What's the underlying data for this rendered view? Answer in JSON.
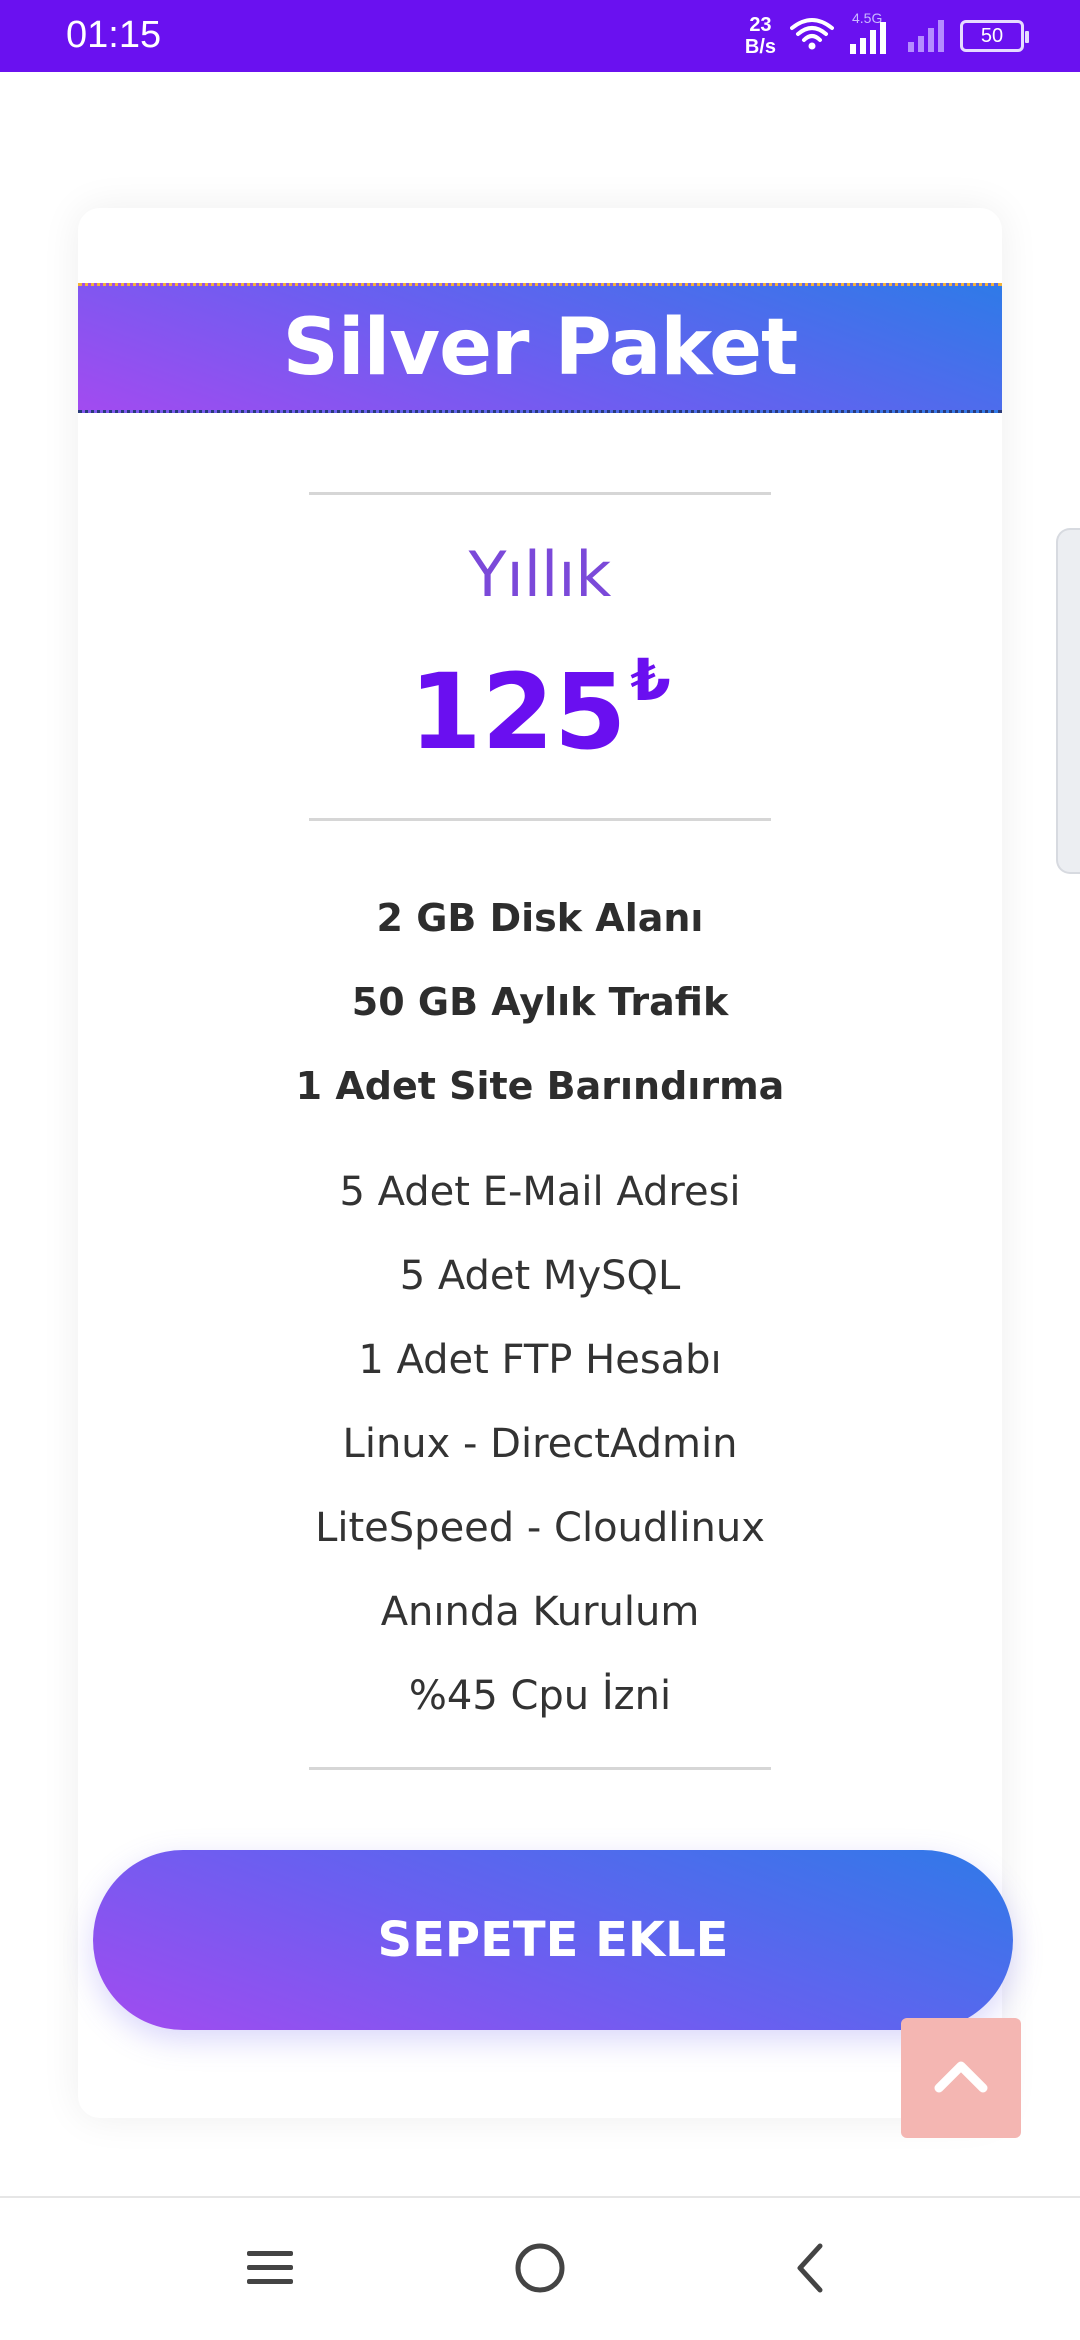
{
  "status_bar": {
    "time": "01:15",
    "net_speed_value": "23",
    "net_speed_unit": "B/s",
    "network_type": "4.5G",
    "battery": "50"
  },
  "card": {
    "title": "Silver Paket",
    "period": "Yıllık",
    "price": "125",
    "currency": "₺",
    "features_bold": [
      "2 GB Disk Alanı",
      "50 GB Aylık Trafik",
      "1 Adet Site Barındırma"
    ],
    "features": [
      "5 Adet E-Mail Adresi",
      "5 Adet MySQL",
      "1 Adet FTP Hesabı",
      "Linux - DirectAdmin",
      "LiteSpeed - Cloudlinux",
      "Anında Kurulum",
      "%45 Cpu İzni"
    ],
    "cta_label": "SEPETE EKLE"
  },
  "colors": {
    "status_bar": "#6a11f0",
    "accent_purple": "#6a0ff0",
    "gradient_start": "#2f7ae8",
    "gradient_end": "#a24bf0",
    "scroll_top_bg": "#f4b6b2"
  },
  "icons": {
    "scroll_top": "chevron-up-icon",
    "nav_menu": "menu-icon",
    "nav_home": "home-circle-icon",
    "nav_back": "back-chevron-icon"
  }
}
